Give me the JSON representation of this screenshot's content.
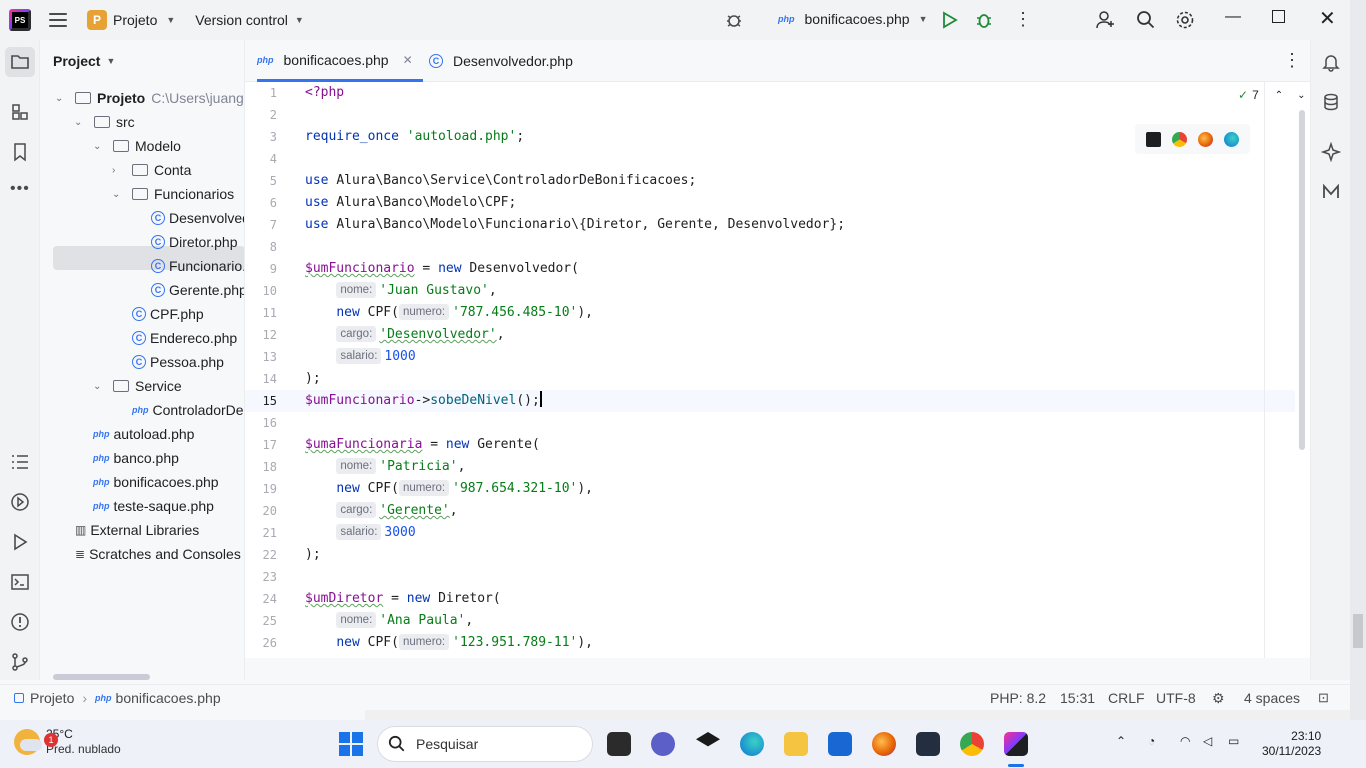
{
  "titlebar": {
    "project_badge": "P",
    "project_name": "Projeto",
    "vcs_label": "Version control",
    "run_config": "bonificacoes.php"
  },
  "project_panel": {
    "title": "Project",
    "root_name": "Projeto",
    "root_path": "C:\\Users\\juang\\",
    "items": [
      {
        "label": "src"
      },
      {
        "label": "Modelo"
      },
      {
        "label": "Conta"
      },
      {
        "label": "Funcionarios"
      },
      {
        "label": "Desenvolvedor.php"
      },
      {
        "label": "Diretor.php"
      },
      {
        "label": "Funcionario.php"
      },
      {
        "label": "Gerente.php"
      },
      {
        "label": "CPF.php"
      },
      {
        "label": "Endereco.php"
      },
      {
        "label": "Pessoa.php"
      },
      {
        "label": "Service"
      },
      {
        "label": "ControladorDeBonificacoes.php"
      },
      {
        "label": "autoload.php"
      },
      {
        "label": "banco.php"
      },
      {
        "label": "bonificacoes.php"
      },
      {
        "label": "teste-saque.php"
      },
      {
        "label": "External Libraries"
      },
      {
        "label": "Scratches and Consoles"
      }
    ]
  },
  "tabs": [
    {
      "label": "bonificacoes.php",
      "active": true,
      "icon": "php-file-icon"
    },
    {
      "label": "Desenvolvedor.php",
      "active": false,
      "icon": "class-icon"
    }
  ],
  "editor": {
    "inspection_count": "7",
    "current_line": 15,
    "line_numbers": [
      "1",
      "2",
      "3",
      "4",
      "5",
      "6",
      "7",
      "8",
      "9",
      "10",
      "11",
      "12",
      "13",
      "14",
      "15",
      "16",
      "17",
      "18",
      "19",
      "20",
      "21",
      "22",
      "23",
      "24",
      "25",
      "26"
    ],
    "code": {
      "l1": "<?php",
      "l3_kw": "require_once",
      "l3_str": "'autoload.php'",
      "l5_kw": "use",
      "l5_rest": "Alura\\Banco\\Service\\ControladorDeBonificacoes;",
      "l6_kw": "use",
      "l6_rest": "Alura\\Banco\\Modelo\\CPF;",
      "l7_kw": "use",
      "l7_rest": "Alura\\Banco\\Modelo\\Funcionario\\{Diretor, Gerente, Desenvolvedor};",
      "l9_var": "$umFuncionario",
      "l9_rest": " = ",
      "l9_new": "new",
      "l9_cls": " Desenvolvedor(",
      "hint_nome": "nome:",
      "hint_numero": "numero:",
      "hint_cargo": "cargo:",
      "hint_salario": "salario:",
      "l10_str": "'Juan Gustavo'",
      "l11_new": "new",
      "l11_cls": " CPF(",
      "l11_str": "'787.456.485-10'",
      "l12_str": "'Desenvolvedor'",
      "l13_num": "1000",
      "l14": ");",
      "l15_var": "$umFuncionario",
      "l15_arrow": "->",
      "l15_fn": "sobeDeNivel",
      "l15_end": "();",
      "l17_var": "$umaFuncionaria",
      "l17_cls": " Gerente(",
      "l18_str": "'Patricia'",
      "l19_str": "'987.654.321-10'",
      "l20_str": "'Gerente'",
      "l21_num": "3000",
      "l24_var": "$umDiretor",
      "l24_cls": " Diretor(",
      "l25_str": "'Ana Paula'",
      "l26_str": "'123.951.789-11'"
    }
  },
  "statusbar": {
    "breadcrumb_project": "Projeto",
    "breadcrumb_file": "bonificacoes.php",
    "php_version": "PHP: 8.2",
    "position": "15:31",
    "line_ending": "CRLF",
    "encoding": "UTF-8",
    "indent": "4 spaces"
  },
  "taskbar": {
    "notification_count": "1",
    "temperature": "25°C",
    "weather": "Pred. nublado",
    "search_placeholder": "Pesquisar",
    "time": "23:10",
    "date": "30/11/2023"
  },
  "colors": {
    "accent": "#3574f0",
    "keyword": "#0033b3",
    "string": "#067d17",
    "number": "#1750eb",
    "variable": "#871094"
  }
}
